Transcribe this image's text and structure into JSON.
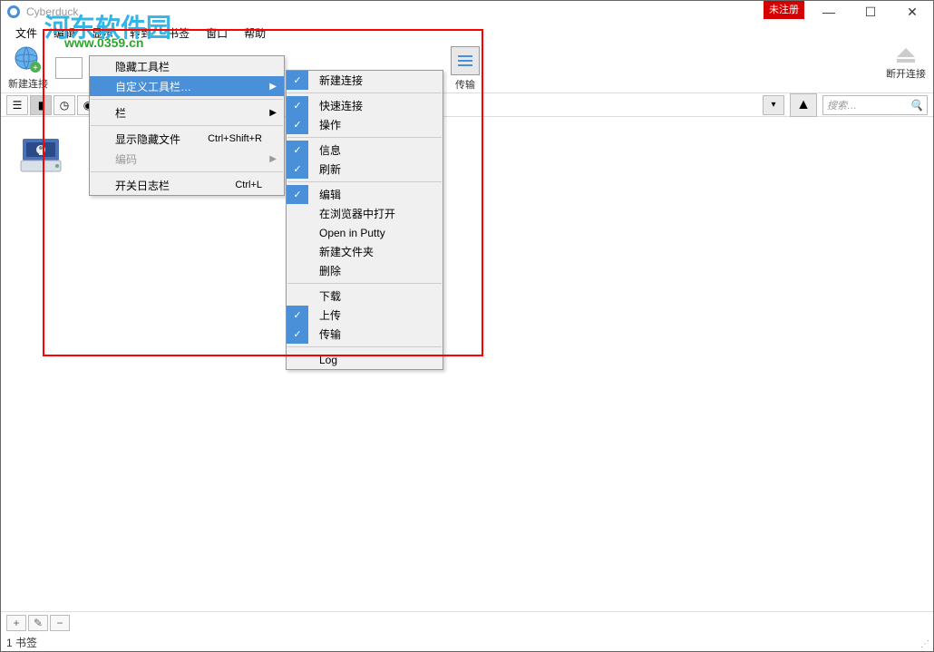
{
  "titlebar": {
    "title": "Cyberduck",
    "badge": "未注册",
    "minimize": "—",
    "maximize": "☐",
    "close": "✕"
  },
  "watermark": {
    "text": "河东软件园",
    "url": "www.0359.cn"
  },
  "menubar": {
    "items": [
      "文件",
      "编辑",
      "显示",
      "转到",
      "书签",
      "窗口",
      "帮助"
    ]
  },
  "toolbar": {
    "new_connection": "新建连接",
    "transfer": "传输",
    "disconnect": "断开连接"
  },
  "search": {
    "placeholder": "搜索…"
  },
  "menu1": {
    "items": [
      {
        "label": "隐藏工具栏",
        "type": "item"
      },
      {
        "label": "自定义工具栏…",
        "type": "highlight",
        "arrow": true
      },
      {
        "type": "sep"
      },
      {
        "label": "栏",
        "type": "item",
        "arrow": true
      },
      {
        "type": "sep"
      },
      {
        "label": "显示隐藏文件",
        "shortcut": "Ctrl+Shift+R",
        "type": "item"
      },
      {
        "label": "编码",
        "type": "disabled",
        "arrow": true
      },
      {
        "type": "sep"
      },
      {
        "label": "开关日志栏",
        "shortcut": "Ctrl+L",
        "type": "item"
      }
    ]
  },
  "menu2": {
    "items": [
      {
        "label": "新建连接",
        "checked": true
      },
      {
        "type": "sep"
      },
      {
        "label": "快速连接",
        "checked": true
      },
      {
        "label": "操作",
        "checked": true
      },
      {
        "type": "sep"
      },
      {
        "label": "信息",
        "checked": true
      },
      {
        "label": "刷新",
        "checked": true
      },
      {
        "type": "sep"
      },
      {
        "label": "编辑",
        "checked": true
      },
      {
        "label": "在浏览器中打开",
        "checked": false
      },
      {
        "label": "Open in Putty",
        "checked": false
      },
      {
        "label": "新建文件夹",
        "checked": false
      },
      {
        "label": "删除",
        "checked": false
      },
      {
        "type": "sep"
      },
      {
        "label": "下载",
        "checked": false
      },
      {
        "label": "上传",
        "checked": true
      },
      {
        "label": "传输",
        "checked": true
      },
      {
        "type": "sep"
      },
      {
        "label": "Log",
        "checked": false
      }
    ]
  },
  "bottombar": {
    "add": "+",
    "edit": "✎",
    "remove": "−"
  },
  "statusbar": {
    "text": "1 书签"
  }
}
